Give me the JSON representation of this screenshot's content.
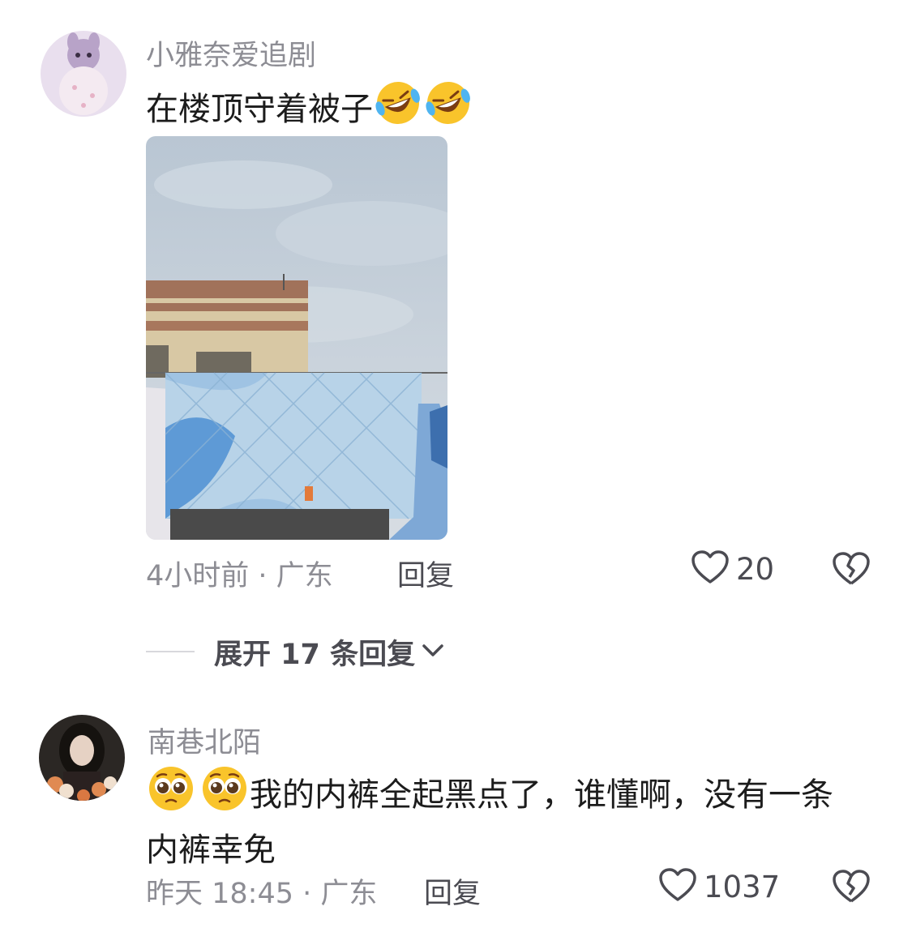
{
  "comments": [
    {
      "username": "小雅奈爱追剧",
      "text": "在楼顶守着被子",
      "emojis": [
        "rolling-laughing-emoji",
        "rolling-laughing-emoji"
      ],
      "meta": "4小时前 · 广东",
      "reply_label": "回复",
      "likes": "20"
    },
    {
      "username": "南巷北陌",
      "text": "我的内裤全起黑点了，谁懂啊，没有一条内裤幸免",
      "emojis": [
        "pleading-face-emoji",
        "pleading-face-emoji"
      ],
      "meta": "昨天 18:45 · 广东",
      "reply_label": "回复",
      "likes": "1037"
    }
  ],
  "expand_replies": {
    "label": "展开 17 条回复"
  },
  "colors": {
    "secondary_text": "#8d8d94",
    "primary_text": "#1c1c1c",
    "action_text": "#4b4b52"
  }
}
